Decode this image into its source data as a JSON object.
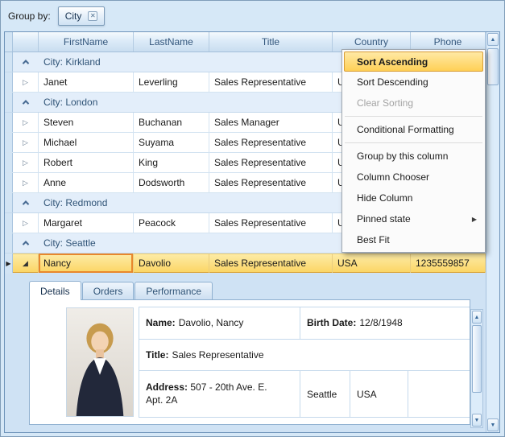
{
  "group_panel": {
    "label": "Group by:",
    "chip": {
      "label": "City"
    }
  },
  "grid": {
    "columns": [
      {
        "key": "firstname",
        "label": "FirstName"
      },
      {
        "key": "lastname",
        "label": "LastName"
      },
      {
        "key": "title",
        "label": "Title"
      },
      {
        "key": "country",
        "label": "Country"
      },
      {
        "key": "phone",
        "label": "Phone"
      }
    ],
    "groups": [
      {
        "label": "City: Kirkland",
        "rows": [
          {
            "cells": [
              "Janet",
              "Leverling",
              "Sales Representative",
              "U",
              ""
            ]
          }
        ]
      },
      {
        "label": "City: London",
        "rows": [
          {
            "cells": [
              "Steven",
              "Buchanan",
              "Sales Manager",
              "U",
              ""
            ]
          },
          {
            "cells": [
              "Michael",
              "Suyama",
              "Sales Representative",
              "U",
              ""
            ]
          },
          {
            "cells": [
              "Robert",
              "King",
              "Sales Representative",
              "U",
              ""
            ]
          },
          {
            "cells": [
              "Anne",
              "Dodsworth",
              "Sales Representative",
              "U",
              ""
            ]
          }
        ]
      },
      {
        "label": "City: Redmond",
        "rows": [
          {
            "cells": [
              "Margaret",
              "Peacock",
              "Sales Representative",
              "U",
              ""
            ]
          }
        ]
      },
      {
        "label": "City: Seattle",
        "rows": [
          {
            "cells": [
              "Nancy",
              "Davolio",
              "Sales Representative",
              "USA",
              "1235559857"
            ],
            "selected": true,
            "expanded": true
          }
        ]
      }
    ]
  },
  "context_menu": {
    "items": [
      {
        "label": "Sort Ascending",
        "highlighted": true
      },
      {
        "label": "Sort Descending"
      },
      {
        "label": "Clear Sorting",
        "disabled": true
      },
      {
        "separator": true
      },
      {
        "label": "Conditional Formatting"
      },
      {
        "separator": true
      },
      {
        "label": "Group by this column"
      },
      {
        "label": "Column Chooser"
      },
      {
        "label": "Hide Column"
      },
      {
        "label": "Pinned state",
        "submenu": true
      },
      {
        "label": "Best Fit"
      }
    ]
  },
  "detail": {
    "tabs": [
      {
        "label": "Details",
        "active": true
      },
      {
        "label": "Orders"
      },
      {
        "label": "Performance"
      }
    ],
    "fields": {
      "name_label": "Name:",
      "name_value": "Davolio, Nancy",
      "birth_label": "Birth Date:",
      "birth_value": "12/8/1948",
      "title_label": "Title:",
      "title_value": "Sales Representative",
      "address_label": "Address:",
      "address_line1": "507 - 20th Ave. E.",
      "address_line2": "Apt. 2A",
      "city": "Seattle",
      "country": "USA"
    }
  },
  "icons": {
    "remove_group": "✕",
    "expand_row": "▷",
    "expanded_row": "◢",
    "focused_row": "▶",
    "submenu_arrow": "▶",
    "scroll_up": "▲",
    "scroll_down": "▼"
  },
  "colors": {
    "selection": "#fbd563",
    "menu_highlight": "#ffd056",
    "focus_border": "#e8872c",
    "header_text": "#33567c"
  }
}
